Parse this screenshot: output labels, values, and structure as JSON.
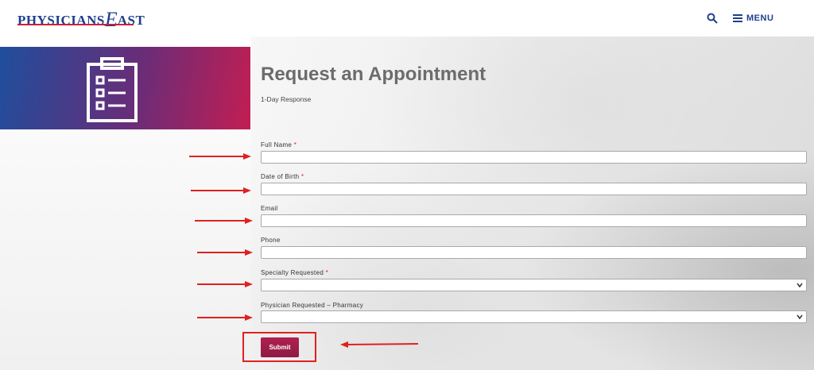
{
  "header": {
    "logo_text_1": "PHYSICIANS",
    "logo_text_2": "E",
    "logo_text_3": "AST",
    "menu_label": "MENU"
  },
  "page": {
    "title": "Request an Appointment",
    "subtitle": "1-Day Response"
  },
  "form": {
    "fields": [
      {
        "label": "Full Name",
        "required": "*",
        "value": ""
      },
      {
        "label": "Date of Birth",
        "required": "*",
        "value": ""
      },
      {
        "label": "Email",
        "required": "",
        "value": ""
      },
      {
        "label": "Phone",
        "required": "",
        "value": ""
      },
      {
        "label": "Specialty Requested",
        "required": "*",
        "value": ""
      },
      {
        "label": "Physician Requested – Pharmacy",
        "required": "",
        "value": ""
      }
    ],
    "submit_label": "Submit"
  },
  "colors": {
    "brand_blue": "#1d3f8c",
    "brand_red": "#c8203f",
    "annotation_red": "#e02020"
  },
  "icons": [
    "search-icon",
    "menu-icon",
    "clipboard-list-icon",
    "chevron-down-icon",
    "arrow-right-icon",
    "arrow-left-icon"
  ]
}
